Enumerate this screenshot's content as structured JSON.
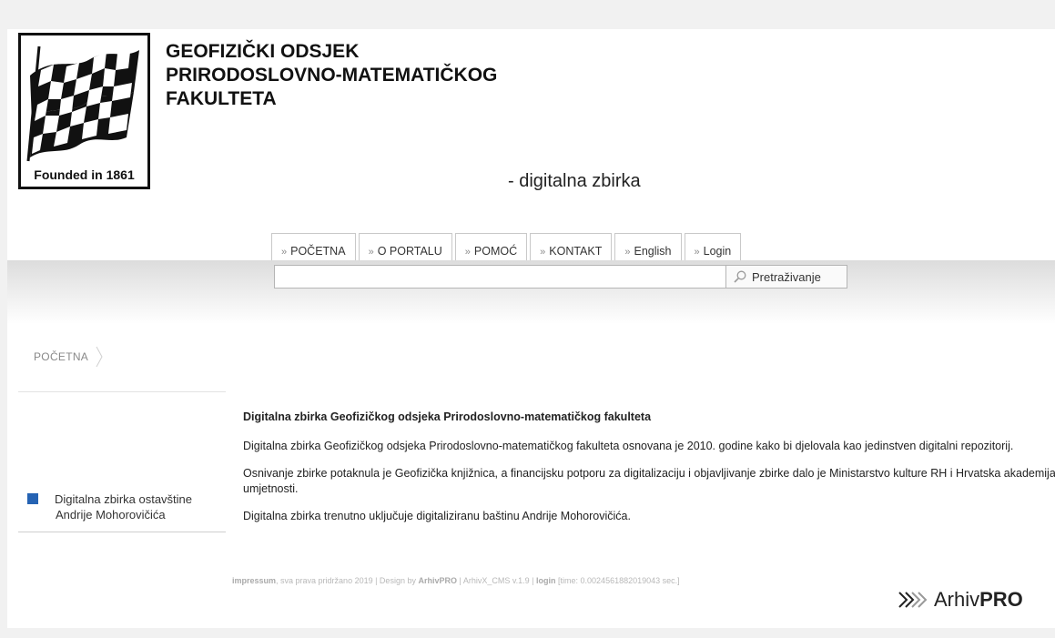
{
  "header": {
    "logo_caption": "Founded in 1861",
    "title_line1": "GEOFIZIČKI ODSJEK",
    "title_line2": "PRIRODOSLOVNO-MATEMATIČKOG",
    "title_line3": "FAKULTETA",
    "subtitle": "- digitalna zbirka"
  },
  "nav": {
    "arrow": "»",
    "items": [
      "POČETNA",
      "O PORTALU",
      "POMOĆ",
      "KONTAKT",
      "English",
      "Login"
    ]
  },
  "search": {
    "value": "",
    "button_label": "Pretraživanje"
  },
  "breadcrumb": {
    "items": [
      "POČETNA"
    ]
  },
  "sidebar": {
    "item_line1": "Digitalna zbirka ostavštine",
    "item_line2": "Andrije Mohorovičića",
    "accent": "#2563b3"
  },
  "main": {
    "heading": "Digitalna zbirka Geofizičkog odsjeka Prirodoslovno-matematičkog fakulteta",
    "p1": "Digitalna zbirka Geofizičkog odsjeka Prirodoslovno-matematičkog fakulteta osnovana je 2010. godine kako bi djelovala kao jedinstven digitalni repozitorij.",
    "p2": "Osnivanje zbirke potaknula je Geofizička knjižnica, a financijsku potporu za digitalizaciju i objavljivanje zbirke dalo je Ministarstvo kulture RH i Hrvatska akademija znanosti i umjetnosti.",
    "p3": "Digitalna zbirka trenutno uključuje digitaliziranu baštinu Andrije Mohorovičića."
  },
  "footer": {
    "impressum": "impressum",
    "rights": ", sva prava pridržano 2019 | Design by ",
    "designer": "ArhivPRO",
    "cms": " | ArhivX_CMS v.1.9 | ",
    "login": "login",
    "time": " [time: 0.0024561882019043 sec.]"
  },
  "brand": {
    "name_a": "Arhiv",
    "name_b": "PRO"
  }
}
